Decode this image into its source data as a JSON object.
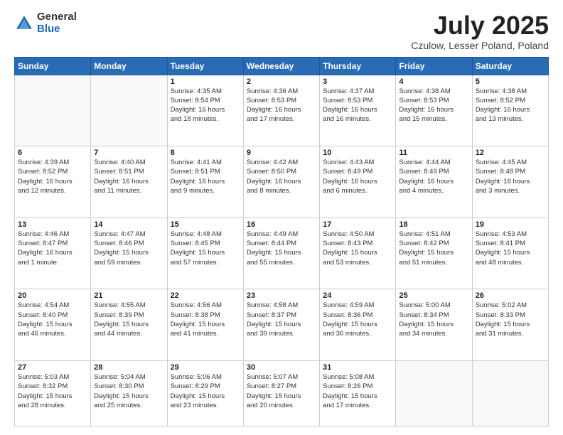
{
  "header": {
    "logo_general": "General",
    "logo_blue": "Blue",
    "month_title": "July 2025",
    "location": "Czulow, Lesser Poland, Poland"
  },
  "days_of_week": [
    "Sunday",
    "Monday",
    "Tuesday",
    "Wednesday",
    "Thursday",
    "Friday",
    "Saturday"
  ],
  "weeks": [
    [
      {
        "day": "",
        "info": ""
      },
      {
        "day": "",
        "info": ""
      },
      {
        "day": "1",
        "info": "Sunrise: 4:35 AM\nSunset: 8:54 PM\nDaylight: 16 hours\nand 18 minutes."
      },
      {
        "day": "2",
        "info": "Sunrise: 4:36 AM\nSunset: 8:53 PM\nDaylight: 16 hours\nand 17 minutes."
      },
      {
        "day": "3",
        "info": "Sunrise: 4:37 AM\nSunset: 8:53 PM\nDaylight: 16 hours\nand 16 minutes."
      },
      {
        "day": "4",
        "info": "Sunrise: 4:38 AM\nSunset: 8:53 PM\nDaylight: 16 hours\nand 15 minutes."
      },
      {
        "day": "5",
        "info": "Sunrise: 4:38 AM\nSunset: 8:52 PM\nDaylight: 16 hours\nand 13 minutes."
      }
    ],
    [
      {
        "day": "6",
        "info": "Sunrise: 4:39 AM\nSunset: 8:52 PM\nDaylight: 16 hours\nand 12 minutes."
      },
      {
        "day": "7",
        "info": "Sunrise: 4:40 AM\nSunset: 8:51 PM\nDaylight: 16 hours\nand 11 minutes."
      },
      {
        "day": "8",
        "info": "Sunrise: 4:41 AM\nSunset: 8:51 PM\nDaylight: 16 hours\nand 9 minutes."
      },
      {
        "day": "9",
        "info": "Sunrise: 4:42 AM\nSunset: 8:50 PM\nDaylight: 16 hours\nand 8 minutes."
      },
      {
        "day": "10",
        "info": "Sunrise: 4:43 AM\nSunset: 8:49 PM\nDaylight: 16 hours\nand 6 minutes."
      },
      {
        "day": "11",
        "info": "Sunrise: 4:44 AM\nSunset: 8:49 PM\nDaylight: 16 hours\nand 4 minutes."
      },
      {
        "day": "12",
        "info": "Sunrise: 4:45 AM\nSunset: 8:48 PM\nDaylight: 16 hours\nand 3 minutes."
      }
    ],
    [
      {
        "day": "13",
        "info": "Sunrise: 4:46 AM\nSunset: 8:47 PM\nDaylight: 16 hours\nand 1 minute."
      },
      {
        "day": "14",
        "info": "Sunrise: 4:47 AM\nSunset: 8:46 PM\nDaylight: 15 hours\nand 59 minutes."
      },
      {
        "day": "15",
        "info": "Sunrise: 4:48 AM\nSunset: 8:45 PM\nDaylight: 15 hours\nand 57 minutes."
      },
      {
        "day": "16",
        "info": "Sunrise: 4:49 AM\nSunset: 8:44 PM\nDaylight: 15 hours\nand 55 minutes."
      },
      {
        "day": "17",
        "info": "Sunrise: 4:50 AM\nSunset: 8:43 PM\nDaylight: 15 hours\nand 53 minutes."
      },
      {
        "day": "18",
        "info": "Sunrise: 4:51 AM\nSunset: 8:42 PM\nDaylight: 15 hours\nand 51 minutes."
      },
      {
        "day": "19",
        "info": "Sunrise: 4:53 AM\nSunset: 8:41 PM\nDaylight: 15 hours\nand 48 minutes."
      }
    ],
    [
      {
        "day": "20",
        "info": "Sunrise: 4:54 AM\nSunset: 8:40 PM\nDaylight: 15 hours\nand 46 minutes."
      },
      {
        "day": "21",
        "info": "Sunrise: 4:55 AM\nSunset: 8:39 PM\nDaylight: 15 hours\nand 44 minutes."
      },
      {
        "day": "22",
        "info": "Sunrise: 4:56 AM\nSunset: 8:38 PM\nDaylight: 15 hours\nand 41 minutes."
      },
      {
        "day": "23",
        "info": "Sunrise: 4:58 AM\nSunset: 8:37 PM\nDaylight: 15 hours\nand 39 minutes."
      },
      {
        "day": "24",
        "info": "Sunrise: 4:59 AM\nSunset: 8:36 PM\nDaylight: 15 hours\nand 36 minutes."
      },
      {
        "day": "25",
        "info": "Sunrise: 5:00 AM\nSunset: 8:34 PM\nDaylight: 15 hours\nand 34 minutes."
      },
      {
        "day": "26",
        "info": "Sunrise: 5:02 AM\nSunset: 8:33 PM\nDaylight: 15 hours\nand 31 minutes."
      }
    ],
    [
      {
        "day": "27",
        "info": "Sunrise: 5:03 AM\nSunset: 8:32 PM\nDaylight: 15 hours\nand 28 minutes."
      },
      {
        "day": "28",
        "info": "Sunrise: 5:04 AM\nSunset: 8:30 PM\nDaylight: 15 hours\nand 25 minutes."
      },
      {
        "day": "29",
        "info": "Sunrise: 5:06 AM\nSunset: 8:29 PM\nDaylight: 15 hours\nand 23 minutes."
      },
      {
        "day": "30",
        "info": "Sunrise: 5:07 AM\nSunset: 8:27 PM\nDaylight: 15 hours\nand 20 minutes."
      },
      {
        "day": "31",
        "info": "Sunrise: 5:08 AM\nSunset: 8:26 PM\nDaylight: 15 hours\nand 17 minutes."
      },
      {
        "day": "",
        "info": ""
      },
      {
        "day": "",
        "info": ""
      }
    ]
  ]
}
